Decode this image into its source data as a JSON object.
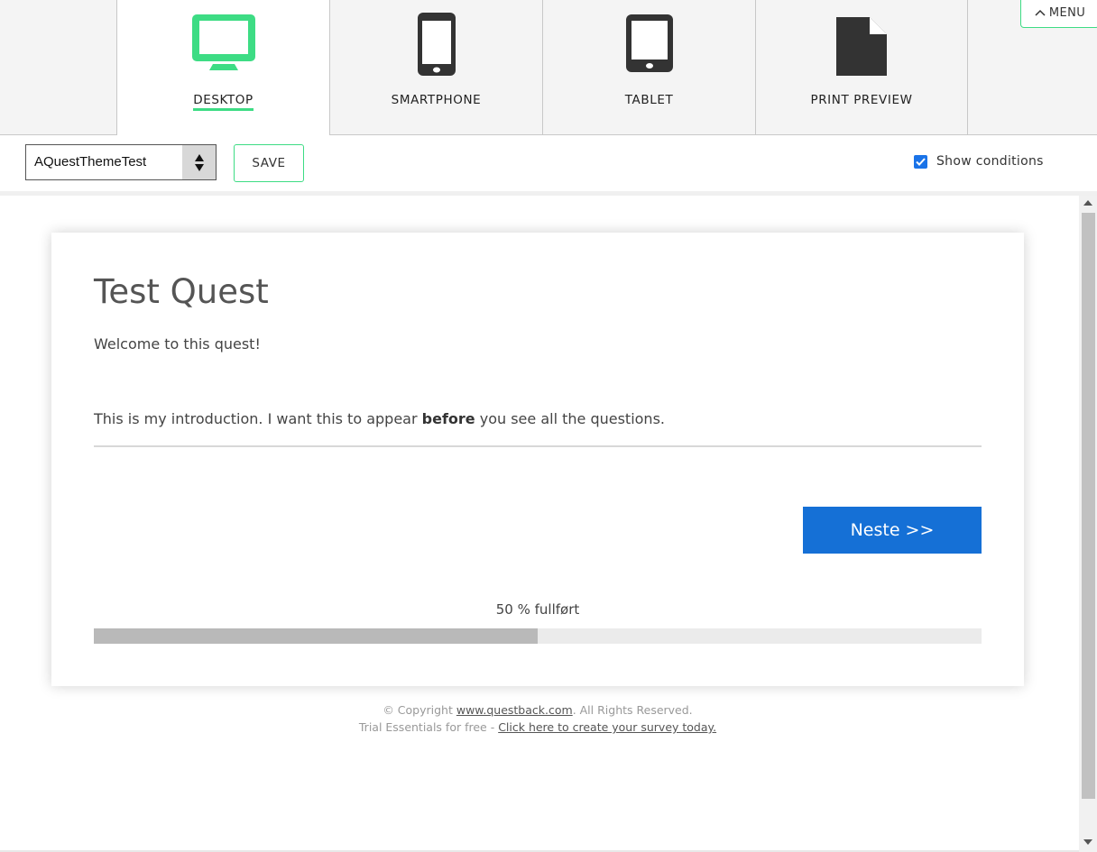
{
  "tabs": [
    {
      "label": "DESKTOP",
      "icon": "desktop-icon",
      "active": true
    },
    {
      "label": "SMARTPHONE",
      "icon": "smartphone-icon",
      "active": false
    },
    {
      "label": "TABLET",
      "icon": "tablet-icon",
      "active": false
    },
    {
      "label": "PRINT PREVIEW",
      "icon": "print-preview-icon",
      "active": false
    }
  ],
  "menu": {
    "label": "MENU",
    "icon": "chevron-up-icon"
  },
  "toolbar": {
    "theme_value": "AQuestThemeTest",
    "save_label": "SAVE",
    "show_conditions_label": "Show conditions",
    "show_conditions_checked": true
  },
  "survey": {
    "title": "Test Quest",
    "welcome": "Welcome to this quest!",
    "intro_before": "This is my introduction. I want this to appear ",
    "intro_bold": "before",
    "intro_after": " you see all the questions.",
    "next_label": "Neste >>",
    "progress_label": "50 % fullført",
    "progress_fraction": 0.5
  },
  "footer": {
    "copyright_prefix": "© Copyright ",
    "copyright_link": "www.questback.com",
    "copyright_suffix": ". All Rights Reserved.",
    "trial_prefix": "Trial Essentials for free - ",
    "trial_link": "Click here to create your survey today."
  },
  "colors": {
    "accent": "#3ddc84",
    "primary_button": "#1570d6",
    "checkbox": "#1a73e8"
  }
}
